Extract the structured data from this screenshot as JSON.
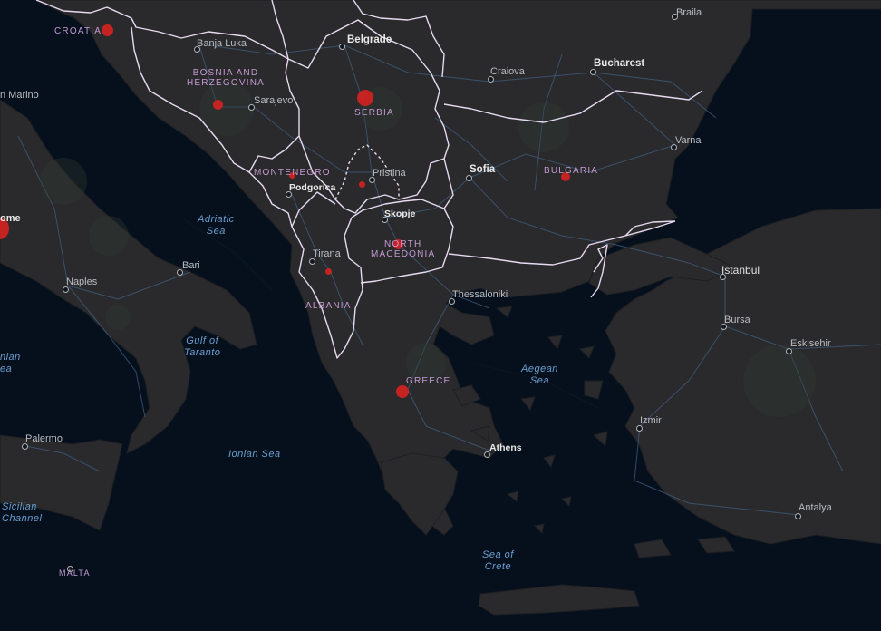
{
  "colors": {
    "water": "#06101d",
    "land": "#2a2a2c",
    "road": "#3f5e80",
    "border": "#e7d9f0",
    "case_marker": "#e02121",
    "country_label": "#c39ad2",
    "sea_label": "#6b9fd0"
  },
  "countries": [
    {
      "id": "croatia",
      "label": "CROATIA"
    },
    {
      "id": "bosnia",
      "label": "BOSNIA AND",
      "label2": "HERZEGOVINA"
    },
    {
      "id": "serbia",
      "label": "SERBIA"
    },
    {
      "id": "montenegro",
      "label": "MONTENEGRO"
    },
    {
      "id": "bulgaria",
      "label": "BULGARIA"
    },
    {
      "id": "north-macedonia",
      "label": "NORTH",
      "label2": "MACEDONIA"
    },
    {
      "id": "albania",
      "label": "ALBANIA"
    },
    {
      "id": "greece",
      "label": "GREECE"
    },
    {
      "id": "malta",
      "label": "MALTA"
    }
  ],
  "seas": [
    {
      "id": "adriatic",
      "label": "Adriatic",
      "label2": "Sea"
    },
    {
      "id": "taranto",
      "label": "Gulf of",
      "label2": "Taranto"
    },
    {
      "id": "ionian",
      "label": "Ionian Sea"
    },
    {
      "id": "aegean",
      "label": "Aegean",
      "label2": "Sea"
    },
    {
      "id": "crete",
      "label": "Sea of",
      "label2": "Crete"
    },
    {
      "id": "sicilian",
      "label": "Sicilian",
      "label2": "Channel"
    },
    {
      "id": "tyrrhenian",
      "label": "nian",
      "label2": "ea"
    }
  ],
  "capitals": [
    {
      "id": "belgrade",
      "label": "Belgrade"
    },
    {
      "id": "bucharest",
      "label": "Bucharest"
    },
    {
      "id": "sofia",
      "label": "Sofia"
    },
    {
      "id": "skopje",
      "label": "Skopje"
    },
    {
      "id": "podgorica",
      "label": "Podgorica"
    },
    {
      "id": "athens",
      "label": "Athens"
    },
    {
      "id": "rome",
      "label": "ome"
    }
  ],
  "cities": [
    {
      "id": "banja-luka",
      "label": "Banja Luka"
    },
    {
      "id": "sarajevo",
      "label": "Sarajevo"
    },
    {
      "id": "craiova",
      "label": "Craiova"
    },
    {
      "id": "braila",
      "label": "Braila"
    },
    {
      "id": "varna",
      "label": "Varna"
    },
    {
      "id": "pristina",
      "label": "Pristina"
    },
    {
      "id": "tirana",
      "label": "Tirana"
    },
    {
      "id": "thessaloniki",
      "label": "Thessaloniki"
    },
    {
      "id": "istanbul",
      "label": "Istanbul"
    },
    {
      "id": "bursa",
      "label": "Bursa"
    },
    {
      "id": "eskisehir",
      "label": "Eskisehir"
    },
    {
      "id": "izmir",
      "label": "Izmir"
    },
    {
      "id": "antalya",
      "label": "Antalya"
    },
    {
      "id": "bari",
      "label": "Bari"
    },
    {
      "id": "naples",
      "label": "Naples"
    },
    {
      "id": "palermo",
      "label": "Palermo"
    },
    {
      "id": "san-marino",
      "label": "n Marino"
    }
  ]
}
